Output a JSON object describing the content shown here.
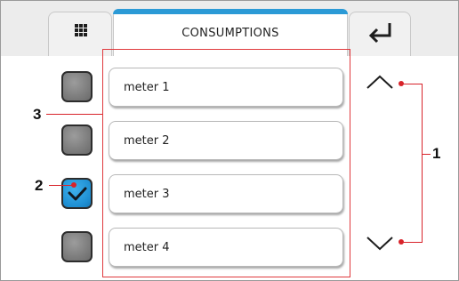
{
  "header": {
    "title": "CONSUMPTIONS",
    "menu_icon": "grid-menu-icon",
    "back_icon": "return-arrow-icon",
    "accent_color": "#2b9ad6"
  },
  "meters": [
    {
      "label": "meter 1",
      "checked": false
    },
    {
      "label": "meter 2",
      "checked": false
    },
    {
      "label": "meter 3",
      "checked": true
    },
    {
      "label": "meter 4",
      "checked": false
    }
  ],
  "navigation": {
    "up_icon": "chevron-up-icon",
    "down_icon": "chevron-down-icon"
  },
  "callouts": {
    "scroll_arrows": "1",
    "checkbox": "2",
    "meter_list": "3",
    "color": "#d8232a"
  }
}
